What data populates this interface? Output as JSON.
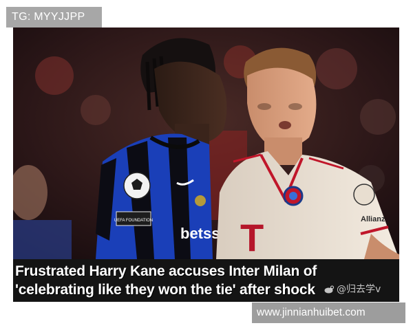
{
  "watermark": {
    "tg_handle": "TG: MYYJJPP",
    "site_url": "www.jinnianhuibet.com",
    "weibo_handle": "@归去学v"
  },
  "photo": {
    "left_player_shirt_sponsor": "betss",
    "left_player_sleeve_patch": "UEFA FOUNDATION",
    "right_player_sleeve_patch": "Allianz",
    "right_player_crest_letter": "T"
  },
  "headline": {
    "line1": "Frustrated Harry Kane accuses Inter Milan of",
    "line2": "'celebrating like they won the tie' after shock"
  },
  "colors": {
    "tg_badge_bg": "#a7a7a7",
    "url_badge_bg": "#9d9d9d",
    "headline_band_bg": "#141414",
    "inter_blue": "#1a3fb8",
    "bayern_cream": "#eee4d8",
    "bayern_red": "#c0162a"
  }
}
